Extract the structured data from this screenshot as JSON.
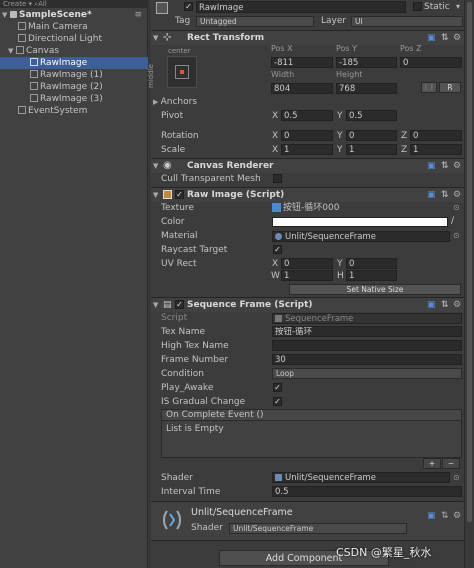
{
  "hierarchy": {
    "toolbar": "Create ▾   ⌕All",
    "scene": "SampleScene*",
    "items": [
      {
        "label": "Main Camera"
      },
      {
        "label": "Directional Light"
      },
      {
        "label": "Canvas"
      },
      {
        "label": "RawImage"
      },
      {
        "label": "RawImage (1)"
      },
      {
        "label": "RawImage (2)"
      },
      {
        "label": "RawImage (3)"
      },
      {
        "label": "EventSystem"
      }
    ]
  },
  "object": {
    "name": "RawImage",
    "static_label": "Static",
    "tag_label": "Tag",
    "tag_value": "Untagged",
    "layer_label": "Layer",
    "layer_value": "UI"
  },
  "rect_transform": {
    "title": "Rect Transform",
    "anchor_h": "center",
    "anchor_v": "middle",
    "pos_x_label": "Pos X",
    "pos_y_label": "Pos Y",
    "pos_z_label": "Pos Z",
    "pos_x": "-811",
    "pos_y": "-185",
    "pos_z": "0",
    "width_label": "Width",
    "height_label": "Height",
    "width": "804",
    "height": "768",
    "r_button": "R",
    "anchors_label": "Anchors",
    "pivot_label": "Pivot",
    "pivot_x": "0.5",
    "pivot_y": "0.5",
    "rotation_label": "Rotation",
    "rot_x": "0",
    "rot_y": "0",
    "rot_z": "0",
    "scale_label": "Scale",
    "scale_x": "1",
    "scale_y": "1",
    "scale_z": "1",
    "x": "X",
    "y": "Y",
    "z": "Z"
  },
  "canvas_renderer": {
    "title": "Canvas Renderer",
    "cull_label": "Cull Transparent Mesh"
  },
  "raw_image": {
    "title": "Raw Image (Script)",
    "texture_label": "Texture",
    "texture_value": "按钮-循环000",
    "color_label": "Color",
    "color_value": "#ffffff",
    "material_label": "Material",
    "material_value": "Unlit/SequenceFrame",
    "raycast_label": "Raycast Target",
    "uvrect_label": "UV Rect",
    "uv_x": "0",
    "uv_y": "0",
    "uv_w": "1",
    "uv_h": "1",
    "x": "X",
    "y": "Y",
    "w": "W",
    "h": "H",
    "native_button": "Set Native Size"
  },
  "sequence_frame": {
    "title": "Sequence Frame (Script)",
    "script_label": "Script",
    "script_value": "SequenceFrame",
    "tex_name_label": "Tex Name",
    "tex_name_value": "按钮-循环",
    "high_tex_label": "High Tex Name",
    "high_tex_value": "",
    "frame_number_label": "Frame Number",
    "frame_number_value": "30",
    "condition_label": "Condition",
    "condition_value": "Loop",
    "play_awake_label": "Play_Awake",
    "gradual_label": "IS Gradual Change",
    "event_label": "On Complete Event ()",
    "event_empty": "List is Empty",
    "plus": "+",
    "minus": "−",
    "shader_label": "Shader",
    "shader_value": "Unlit/SequenceFrame",
    "interval_label": "Interval Time",
    "interval_value": "0.5"
  },
  "material": {
    "name": "Unlit/SequenceFrame",
    "shader_label": "Shader",
    "shader_value": "Unlit/SequenceFrame"
  },
  "add_component": "Add Component",
  "watermark": "CSDN @繁星_秋水",
  "colors": {
    "selection": "#3e5f96",
    "accent_blue": "#5a8ed6"
  }
}
